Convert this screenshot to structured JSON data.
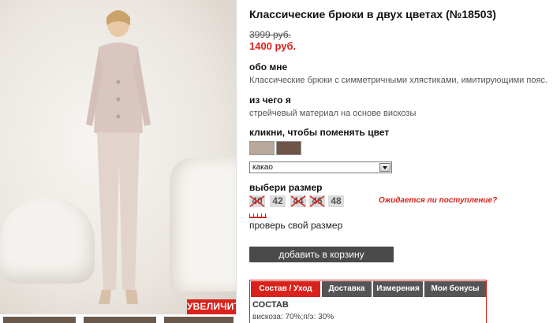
{
  "product": {
    "title": "Классические брюки в двух цветах (№18503)",
    "old_price": "3999 руб.",
    "new_price": "1400 руб."
  },
  "photo": {
    "zoom_label": "УВЕЛИЧИТЬ"
  },
  "about": {
    "label": "обо мне",
    "text": "Классические брюки с симметричными хлястиками, имитирующими пояс."
  },
  "material": {
    "label": "из чего я",
    "text": "стрейчевый материал на основе вискозы"
  },
  "color": {
    "label": "кликни, чтобы поменять цвет",
    "swatches": [
      {
        "name": "beige",
        "color": "#b7a89b"
      },
      {
        "name": "cacao",
        "color": "#6e5548"
      }
    ],
    "selected": "какао"
  },
  "size": {
    "label": "выбери размер",
    "options": [
      {
        "value": "40",
        "available": false
      },
      {
        "value": "42",
        "available": true
      },
      {
        "value": "44",
        "available": false
      },
      {
        "value": "46",
        "available": false
      },
      {
        "value": "48",
        "available": true
      }
    ],
    "waiting_link": "Ожидается ли поступление?",
    "check_size": "проверь свой размер"
  },
  "cart": {
    "button_label": "добавить в корзину"
  },
  "tabs": {
    "items": [
      {
        "label": "Состав / Уход",
        "active": true
      },
      {
        "label": "Доставка",
        "active": false
      },
      {
        "label": "Измерения",
        "active": false
      },
      {
        "label": "Мои бонусы",
        "active": false
      }
    ],
    "body_title": "СОСТАВ",
    "body_text": "вискоза: 70%;п/э: 30%"
  },
  "colors": {
    "accent": "#d9221c",
    "button_dark": "#4a4a4a",
    "tab_inactive": "#555555"
  }
}
